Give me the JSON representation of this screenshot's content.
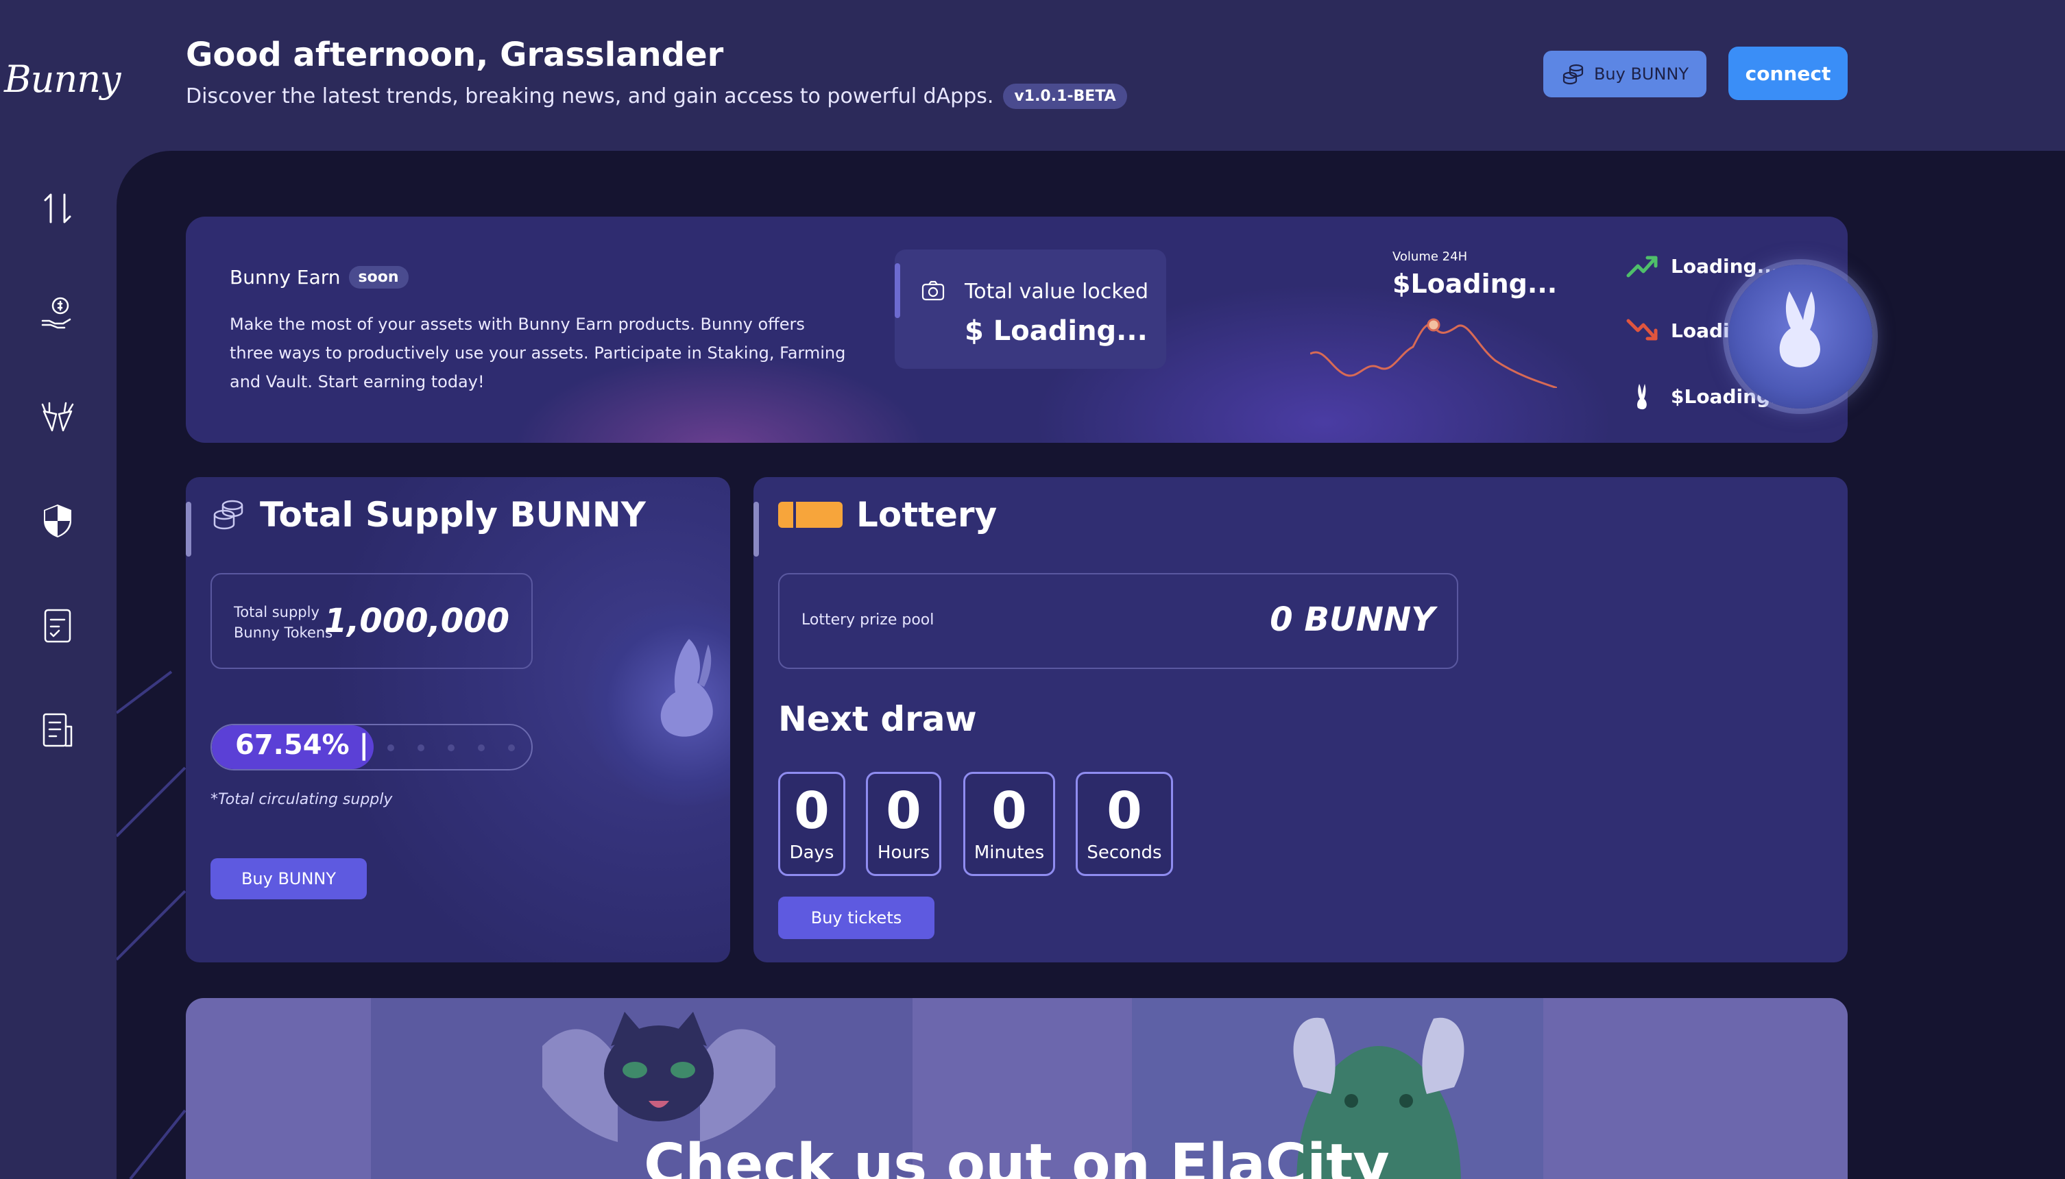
{
  "app": {
    "logo_text": "Bunny"
  },
  "header": {
    "greeting": "Good afternoon, Grasslander",
    "subtitle": "Discover the latest trends, breaking news, and gain access to powerful dApps.",
    "version": "v1.0.1-BETA",
    "buy_label": "Buy BUNNY",
    "connect_label": "connect"
  },
  "sidebar": {
    "items": [
      {
        "icon": "swap-icon"
      },
      {
        "icon": "earn-hand-icon"
      },
      {
        "icon": "carrots-icon"
      },
      {
        "icon": "shield-icon"
      },
      {
        "icon": "checklist-icon"
      },
      {
        "icon": "document-icon"
      }
    ]
  },
  "earn": {
    "title": "Bunny Earn",
    "soon": "soon",
    "description": "Make the most of your assets with Bunny Earn products. Bunny offers three ways to productively use your assets. Participate in Staking, Farming and Vault. Start earning today!",
    "tvl_label": "Total value locked",
    "tvl_value": "$ Loading...",
    "volume_label": "Volume 24H",
    "volume_value": "$Loading...",
    "stats": [
      {
        "icon": "trend-up-icon",
        "value": "Loading...",
        "color": "#4fbf6a"
      },
      {
        "icon": "trend-down-icon",
        "value": "Loading...",
        "color": "#e0553e"
      },
      {
        "icon": "bunny-price-icon",
        "value": "$Loading..."
      }
    ]
  },
  "supply": {
    "title": "Total Supply BUNNY",
    "label_line1": "Total supply",
    "label_line2": "Bunny Tokens",
    "value": "1,000,000",
    "percent_text": "67.54% |",
    "note": "*Total circulating supply",
    "buy_label": "Buy BUNNY"
  },
  "lottery": {
    "title": "Lottery",
    "prize_label": "Lottery prize pool",
    "prize_value": "0 BUNNY",
    "next_draw": "Next draw",
    "countdown": [
      {
        "value": "0",
        "unit": "Days"
      },
      {
        "value": "0",
        "unit": "Hours"
      },
      {
        "value": "0",
        "unit": "Minutes"
      },
      {
        "value": "0",
        "unit": "Seconds"
      }
    ],
    "buy_tickets": "Buy tickets"
  },
  "banner": {
    "title": "Check us out on ElaCity"
  },
  "colors": {
    "accent": "#5e5ae0",
    "connect": "#3a8ef7",
    "background": "#2c2a5a",
    "panel": "#151430"
  }
}
